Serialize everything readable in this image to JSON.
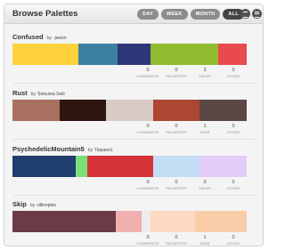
{
  "header": {
    "title": "Browse Palettes",
    "filters": [
      "DAY",
      "WEEK",
      "MONTH",
      "ALL"
    ],
    "active_filter": "ALL",
    "view_buttons": [
      "grid-view-icon",
      "list-view-icon"
    ]
  },
  "stat_labels": {
    "comments": "COMMENTS",
    "favorites": "FAVORITES",
    "views": "VIEWS",
    "view": "VIEW",
    "loves": "LOVES"
  },
  "palettes": [
    {
      "name": "Confused",
      "by": "by",
      "author": "-jwoon",
      "colors": [
        {
          "hex": "#fed33b",
          "weight": 0.28
        },
        {
          "hex": "#3c81a2",
          "weight": 0.17
        },
        {
          "hex": "#2f3677",
          "weight": 0.14
        },
        {
          "hex": "#8fbd2f",
          "weight": 0.29
        },
        {
          "hex": "#e84a4e",
          "weight": 0.12
        }
      ],
      "comments": "0",
      "favorites": "0",
      "views": "3",
      "views_label": "VIEWS",
      "loves": "0"
    },
    {
      "name": "Rust",
      "by": "by",
      "author": "Setsuma Seili",
      "colors": [
        {
          "hex": "#a8705e",
          "weight": 0.2
        },
        {
          "hex": "#2f1510",
          "weight": 0.2
        },
        {
          "hex": "#d9cbc5",
          "weight": 0.2
        },
        {
          "hex": "#ad4632",
          "weight": 0.2
        },
        {
          "hex": "#5b4845",
          "weight": 0.2
        }
      ],
      "comments": "0",
      "favorites": "0",
      "views": "1",
      "views_label": "VIEW",
      "loves": "0"
    },
    {
      "name": "PsychedelicMountain5",
      "by": "by",
      "author": "Tsquare1",
      "colors": [
        {
          "hex": "#203f70",
          "weight": 0.27
        },
        {
          "hex": "#7be07a",
          "weight": 0.05
        },
        {
          "hex": "#d43438",
          "weight": 0.28
        },
        {
          "hex": "#c3ddf4",
          "weight": 0.2
        },
        {
          "hex": "#e4ccf8",
          "weight": 0.2
        }
      ],
      "comments": "0",
      "favorites": "0",
      "views": "0",
      "views_label": "VIEWS",
      "loves": "0"
    },
    {
      "name": "Skip",
      "by": "by",
      "author": "zillionpies",
      "colors": [
        {
          "hex": "#6b3c48",
          "weight": 0.44
        },
        {
          "hex": "#f1b0b0",
          "weight": 0.11
        },
        {
          "hex": "#ececec",
          "weight": 0.04
        },
        {
          "hex": "#fcd9c2",
          "weight": 0.19
        },
        {
          "hex": "#f9cca8",
          "weight": 0.22
        }
      ],
      "comments": "0",
      "favorites": "0",
      "views": "1",
      "views_label": "VIEW",
      "loves": "0"
    }
  ]
}
